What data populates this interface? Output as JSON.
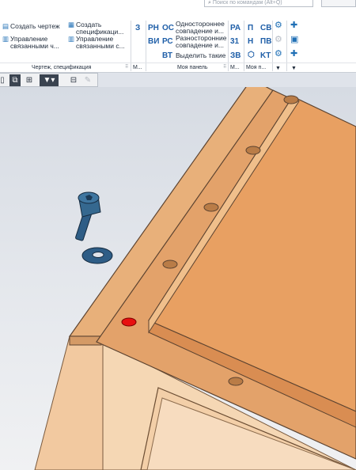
{
  "search": {
    "placeholder": "Поиск по командам (Alt+Q)"
  },
  "ribbon": {
    "group1": {
      "create_drawing": "Создать чертеж",
      "manage_linked_1": "Управление",
      "manage_linked_2": "связанными ч...",
      "create_spec_1": "Создать",
      "create_spec_2": "спецификаци...",
      "manage_spec_1": "Управление",
      "manage_spec_2": "связанными с...",
      "label": "Чертеж, спецификация"
    },
    "group2": {
      "code": "З",
      "label": "М..."
    },
    "group3": {
      "codes": [
        "PH",
        "ВИ",
        "ОС",
        "РС",
        "ВТ"
      ],
      "one_sided_1": "Одностороннее",
      "one_sided_2": "совпадение и...",
      "two_sided_1": "Разносторонние",
      "two_sided_2": "совпадение и...",
      "select_same": "Выделить такие",
      "label": "Моя панель"
    },
    "group4": {
      "codes": [
        "PA",
        "31",
        "ЗВ"
      ],
      "label": "М..."
    },
    "group5": {
      "codes": [
        "П",
        "CB",
        "H",
        "ПВ",
        "KT"
      ],
      "label": "Моя п..."
    }
  },
  "toolbar": {
    "icons": [
      "tree-view-icon",
      "filter-tree-icon",
      "filter-icon",
      "dropdown-icon",
      "table-icon",
      "eraser-icon"
    ]
  },
  "colors": {
    "board_face": "#e8a062",
    "board_side": "#d98d52",
    "fastener": "#2e5d86",
    "highlighted_hole": "#e81010"
  }
}
